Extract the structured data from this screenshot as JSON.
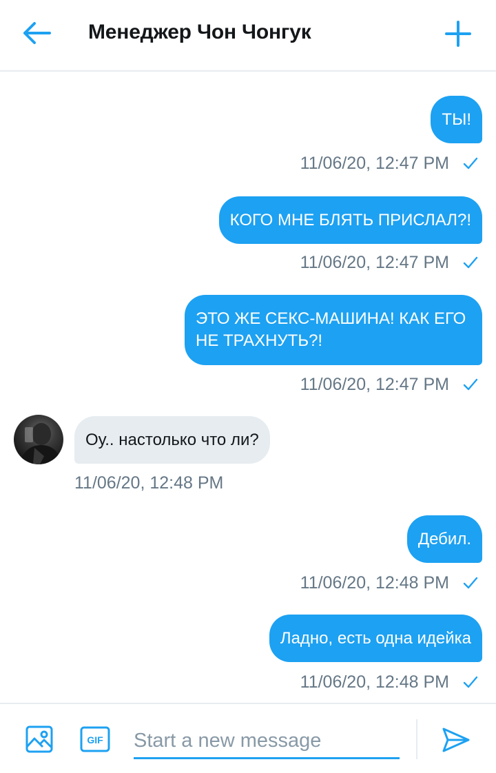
{
  "header": {
    "title": "Менеджер Чон Чонгук"
  },
  "messages": [
    {
      "direction": "out",
      "text": "ТЫ!",
      "time": "11/06/20, 12:47 PM"
    },
    {
      "direction": "out",
      "text": "КОГО МНЕ БЛЯТЬ ПРИСЛАЛ?!",
      "time": "11/06/20, 12:47 PM"
    },
    {
      "direction": "out",
      "text": "ЭТО ЖЕ СЕКС-МАШИНА! КАК ЕГО НЕ ТРАХНУТЬ?!",
      "time": "11/06/20, 12:47 PM"
    },
    {
      "direction": "in",
      "text": "Оу.. настолько что ли?",
      "time": "11/06/20, 12:48 PM"
    },
    {
      "direction": "out",
      "text": "Дебил.",
      "time": "11/06/20, 12:48 PM"
    },
    {
      "direction": "out",
      "text": "Ладно, есть одна идейка",
      "time": "11/06/20, 12:48 PM"
    }
  ],
  "composer": {
    "placeholder": "Start a new message",
    "value": "",
    "gif_label": "GIF"
  },
  "colors": {
    "accent": "#1da1f2",
    "incoming_bubble": "#e6ecf0",
    "meta_text": "#657786"
  },
  "icons": {
    "back": "arrow-left-icon",
    "add": "plus-icon",
    "read_receipt": "checkmark-icon",
    "image": "image-icon",
    "gif": "gif-icon",
    "send": "send-icon"
  }
}
